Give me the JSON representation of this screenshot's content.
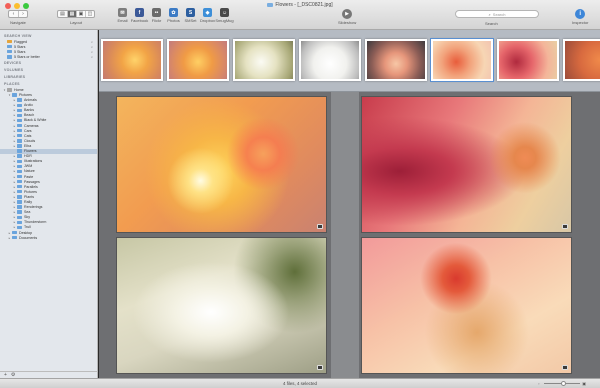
{
  "window": {
    "title": "Flowers - [_DSC0821.jpg]"
  },
  "toolbar": {
    "navigate_label": "Navigate",
    "layout_label": "Layout",
    "share": [
      {
        "label": "Email",
        "icon": "envelope-icon",
        "color": "#7d7d7d",
        "glyph": "✉"
      },
      {
        "label": "Facebook",
        "icon": "facebook-icon",
        "color": "#3b5998",
        "glyph": "f"
      },
      {
        "label": "Flickr",
        "icon": "flickr-icon",
        "color": "#6b6b6b",
        "glyph": "••"
      },
      {
        "label": "Photos",
        "icon": "photos-icon",
        "color": "#3c7bc5",
        "glyph": "✿"
      },
      {
        "label": "SMSet",
        "icon": "smset-icon",
        "color": "#2d5fa0",
        "glyph": "S"
      },
      {
        "label": "Dropbox",
        "icon": "dropbox-icon",
        "color": "#3e8fd8",
        "glyph": "◆"
      },
      {
        "label": "SmugMug",
        "icon": "smugmug-icon",
        "color": "#4a4a4a",
        "glyph": "☺"
      }
    ],
    "slideshow_label": "Slideshow",
    "search_placeholder": "Search",
    "search_label": "Search",
    "inspector_label": "Inspector"
  },
  "sidebar": {
    "search_header": "SEARCH VIEW",
    "searches": [
      {
        "label": "Flagged",
        "type": "flag"
      },
      {
        "label": "5 Stars",
        "type": "folder"
      },
      {
        "label": "5 Stars",
        "type": "folder"
      },
      {
        "label": "5 Stars or better",
        "type": "folder"
      }
    ],
    "devices_header": "DEVICES",
    "volumes_header": "VOLUMES",
    "libraries_header": "LIBRARIES",
    "places_header": "PLACES",
    "places": [
      {
        "label": "Home",
        "disc": "▾",
        "type": "disk",
        "indent": 0
      },
      {
        "label": "Pictures",
        "disc": "▾",
        "type": "folder",
        "indent": 1
      },
      {
        "label": "Animals",
        "disc": "▸",
        "type": "folder",
        "indent": 2
      },
      {
        "label": "Arctic",
        "disc": "▸",
        "type": "folder",
        "indent": 2
      },
      {
        "label": "Banks",
        "disc": "▸",
        "type": "folder",
        "indent": 2
      },
      {
        "label": "Beach",
        "disc": "▸",
        "type": "folder",
        "indent": 2
      },
      {
        "label": "Black & White",
        "disc": "▸",
        "type": "folder",
        "indent": 2
      },
      {
        "label": "Cameras",
        "disc": "▸",
        "type": "folder",
        "indent": 2
      },
      {
        "label": "Cars",
        "disc": "▸",
        "type": "folder",
        "indent": 2
      },
      {
        "label": "Cats",
        "disc": "▸",
        "type": "folder",
        "indent": 2
      },
      {
        "label": "Clouds",
        "disc": "▸",
        "type": "folder",
        "indent": 2
      },
      {
        "label": "Elba",
        "disc": "▸",
        "type": "folder",
        "indent": 2
      },
      {
        "label": "Flowers",
        "disc": "",
        "type": "folder",
        "indent": 2,
        "selected": true
      },
      {
        "label": "HDR",
        "disc": "▸",
        "type": "folder",
        "indent": 2
      },
      {
        "label": "Illustrations",
        "disc": "▸",
        "type": "folder",
        "indent": 2
      },
      {
        "label": "JWM",
        "disc": "▸",
        "type": "folder",
        "indent": 2
      },
      {
        "label": "Nature",
        "disc": "▸",
        "type": "folder",
        "indent": 2
      },
      {
        "label": "Paste",
        "disc": "▸",
        "type": "folder",
        "indent": 2
      },
      {
        "label": "Passages",
        "disc": "▸",
        "type": "folder",
        "indent": 2
      },
      {
        "label": "Parallels",
        "disc": "▸",
        "type": "folder",
        "indent": 2
      },
      {
        "label": "Pictures",
        "disc": "▸",
        "type": "folder",
        "indent": 2
      },
      {
        "label": "Plants",
        "disc": "▸",
        "type": "folder",
        "indent": 2
      },
      {
        "label": "Rally",
        "disc": "▸",
        "type": "folder",
        "indent": 2
      },
      {
        "label": "Renderings",
        "disc": "▸",
        "type": "folder",
        "indent": 2
      },
      {
        "label": "Sea",
        "disc": "▸",
        "type": "folder",
        "indent": 2
      },
      {
        "label": "Sky",
        "disc": "▸",
        "type": "folder",
        "indent": 2
      },
      {
        "label": "Thunderstorm",
        "disc": "▸",
        "type": "folder",
        "indent": 2
      },
      {
        "label": "Trull",
        "disc": "▸",
        "type": "folder",
        "indent": 2
      },
      {
        "label": "Desktop",
        "disc": "▸",
        "type": "folder",
        "indent": 1
      },
      {
        "label": "Documents",
        "disc": "▸",
        "type": "folder",
        "indent": 1
      }
    ],
    "footer_add": "+",
    "footer_gear": "⚙"
  },
  "filmstrip": [
    {
      "name": "thumb-orange-stamen",
      "bg": "radial-gradient(circle at 55% 50%, #ffd36a 0%, #f2a446 35%, #d98a5a 70%, #c47a72 100%)",
      "selected": false
    },
    {
      "name": "thumb-orange-stamen-2",
      "bg": "radial-gradient(circle at 50% 55%, #ffcf63 0%, #f09b45 40%, #d88867 75%, #c27b7c 100%)",
      "selected": false
    },
    {
      "name": "thumb-white-stamen",
      "bg": "radial-gradient(circle at 45% 55%, #fbfbf4 0%, #e5e2c2 40%, #a8a877 80%, #7e7f58 100%)",
      "selected": false
    },
    {
      "name": "thumb-white-petals",
      "bg": "radial-gradient(circle at 50% 60%, #ffffff 0%, #f1f1ee 45%, #bdbdbd 80%, #8f8f8f 100%)",
      "selected": false
    },
    {
      "name": "thumb-pink-flower-dark",
      "bg": "radial-gradient(circle at 50% 60%, #f7c7a6 0%, #e6967b 30%, #8c5d56 65%, #3d3a3e 100%)",
      "selected": false
    },
    {
      "name": "thumb-pink-stamen",
      "bg": "radial-gradient(circle at 40% 55%, #e85d3b 0%, #f2a37c 35%, #f7d6b4 70%, #f2c4b0 100%)",
      "selected": true
    },
    {
      "name": "thumb-red-hibiscus",
      "bg": "radial-gradient(circle at 30% 55%, #b02a3e 0%, #e6666b 35%, #f4b59a 70%, #e8cfa4 100%)",
      "selected": false
    },
    {
      "name": "thumb-partial",
      "bg": "radial-gradient(circle at 60% 50%, #f08a4a 0%, #d86a3f 50%, #9c4c3a 100%)",
      "selected": false
    }
  ],
  "photos": [
    {
      "name": "photo-orange-stamen"
    },
    {
      "name": "photo-red-hibiscus"
    },
    {
      "name": "photo-white-stamen"
    },
    {
      "name": "photo-pink-stamen"
    }
  ],
  "status": {
    "text": "4 files, 4 selected",
    "zoom_level": 0.55
  }
}
